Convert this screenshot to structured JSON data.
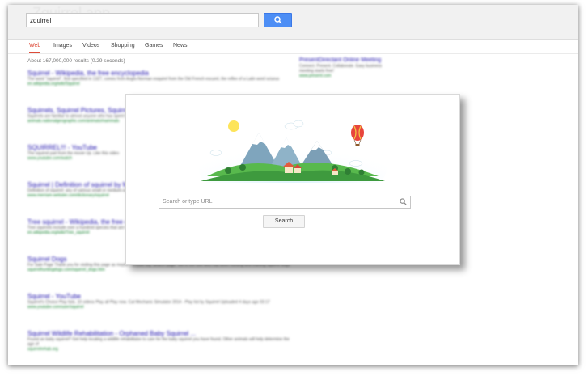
{
  "app": {
    "ghost_title": "Zquirrel app"
  },
  "search": {
    "query": "zquirrel"
  },
  "tabs": [
    {
      "label": "Web",
      "active": true
    },
    {
      "label": "Images"
    },
    {
      "label": "Videos"
    },
    {
      "label": "Shopping"
    },
    {
      "label": "Games"
    },
    {
      "label": "News"
    }
  ],
  "results_count": "About 167,000,000 results (0.29 seconds)",
  "results": [
    {
      "title": "Squirrel - Wikipedia, the free encyclopedia",
      "snippet": "The word \"squirrel\", first specified in 1327, comes from Anglo-Norman esquirel from the Old French escurel, the reflex of a Latin word sciurus",
      "url": "en.wikipedia.org/wiki/Squirrel"
    },
    {
      "title": "Squirrels, Squirrel Pictures, Squirrel Facts",
      "snippet": "Squirrels are familiar to almost anyone who has spent time in parks and woodlands. The Eastern gray squirrel is native",
      "url": "animals.nationalgeographic.com/animals/mammals"
    },
    {
      "title": "SQUIRREL!!! - YouTube",
      "snippet": "The squirrel part from the movie Up. Like this video",
      "url": "www.youtube.com/watch"
    },
    {
      "title": "Squirrel | Definition of squirrel by Merriam-Webster",
      "snippet": "Definition of squirrel: any of various small or medium-sized rodents. Dogs of squirrel, any of several animals",
      "url": "www.merriam-webster.com/dictionary/squirrel"
    },
    {
      "title": "Tree squirrel - Wikipedia, the free encyclopedia",
      "snippet": "Tree squirrels include over a hundred species that are found on every continent except Antarctica. They are",
      "url": "en.wikipedia.org/wiki/Tree_squirrel"
    },
    {
      "title": "Squirrel Dogs",
      "snippet": "For Sale Page Thank you for visiting this page as maybe I should say Search page. We're the one who has been hunting and training squirrel dogs",
      "url": "squirrelhuntingdogs.com/squirrel_dogs.htm"
    },
    {
      "title": "Squirrel - YouTube",
      "snippet": "Squirrel's Choice Play lists. 10 videos Play all Play now. Cat Mechanic Simulator 2014 - Play list by Squirrel Uploaded 4 days ago 03:17",
      "url": "www.youtube.com/user/squirrel"
    },
    {
      "title": "Squirrel Wildlife Rehabilitation - Orphaned Baby Squirrel ...",
      "snippet": "Found an baby squirrel? Get help locating a wildlife rehabilitator to care for the baby squirrel you have found. Other animals will help determine the age of",
      "url": "squirrelrehab.org"
    }
  ],
  "ad": {
    "title": "PresentDirectant Online Meeting",
    "snippet": "Connect. Present. Collaborate. Easy business meeting starts free!",
    "url": "www.present.com"
  },
  "modal": {
    "url_placeholder": "Search or type URL",
    "search_label": "Search"
  },
  "colors": {
    "accent": "#4d8ef5",
    "active_tab": "#dd4b39",
    "link": "#1a0dab",
    "url_green": "#0a7c25"
  },
  "icons": {
    "search_button": "search-icon",
    "url_field": "search-icon",
    "illustration": "landscape-illustration"
  }
}
